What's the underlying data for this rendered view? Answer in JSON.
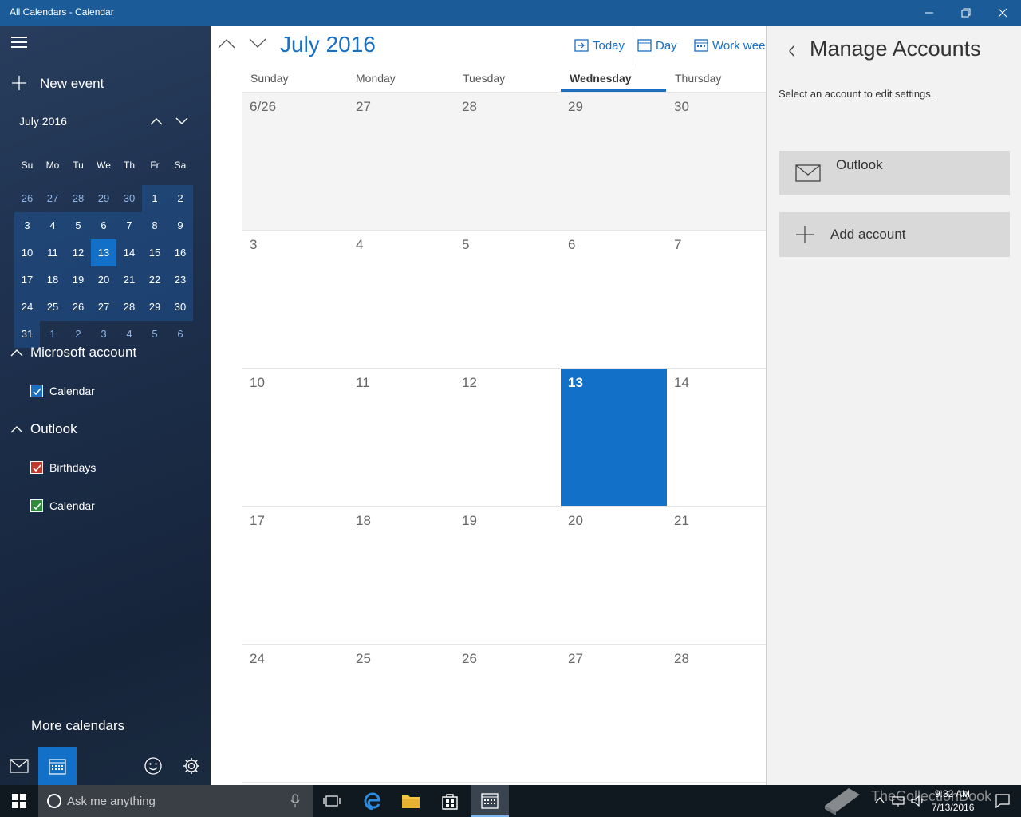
{
  "window": {
    "title": "All Calendars - Calendar"
  },
  "sidebar": {
    "new_event": "New event",
    "mini_month": "July 2016",
    "dow": [
      "Su",
      "Mo",
      "Tu",
      "We",
      "Th",
      "Fr",
      "Sa"
    ],
    "weeks": [
      [
        "26",
        "27",
        "28",
        "29",
        "30",
        "1",
        "2"
      ],
      [
        "3",
        "4",
        "5",
        "6",
        "7",
        "8",
        "9"
      ],
      [
        "10",
        "11",
        "12",
        "13",
        "14",
        "15",
        "16"
      ],
      [
        "17",
        "18",
        "19",
        "20",
        "21",
        "22",
        "23"
      ],
      [
        "24",
        "25",
        "26",
        "27",
        "28",
        "29",
        "30"
      ],
      [
        "31",
        "1",
        "2",
        "3",
        "4",
        "5",
        "6"
      ]
    ],
    "accounts": [
      {
        "name": "Microsoft account",
        "calendars": [
          {
            "label": "Calendar",
            "color": "#1a6fc0"
          }
        ]
      },
      {
        "name": "Outlook",
        "calendars": [
          {
            "label": "Birthdays",
            "color": "#c0392b"
          },
          {
            "label": "Calendar",
            "color": "#2e8b3a"
          }
        ]
      }
    ],
    "more_calendars": "More calendars"
  },
  "main": {
    "month_title": "July 2016",
    "toolbar": {
      "today": "Today",
      "day": "Day",
      "work_week": "Work weel"
    },
    "columns": [
      "Sunday",
      "Monday",
      "Tuesday",
      "Wednesday",
      "Thursday"
    ],
    "rows": [
      [
        "6/26",
        "27",
        "28",
        "29",
        "30"
      ],
      [
        "3",
        "4",
        "5",
        "6",
        "7"
      ],
      [
        "10",
        "11",
        "12",
        "13",
        "14"
      ],
      [
        "17",
        "18",
        "19",
        "20",
        "21"
      ],
      [
        "24",
        "25",
        "26",
        "27",
        "28"
      ]
    ]
  },
  "panel": {
    "title": "Manage Accounts",
    "subtitle": "Select an account to edit settings.",
    "accounts": [
      {
        "label": "Outlook"
      }
    ],
    "add_account": "Add account"
  },
  "taskbar": {
    "search_placeholder": "Ask me anything",
    "time": "9:32 AM",
    "date": "7/13/2016",
    "watermark": "TheCollectionBook"
  },
  "colors": {
    "accent": "#1a6fc0",
    "today": "#1270c8",
    "titlebar": "#1a5b98"
  }
}
